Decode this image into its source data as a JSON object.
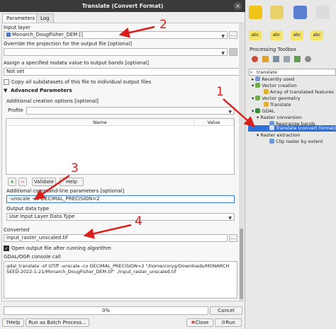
{
  "window": {
    "title": "Translate (Convert Format)",
    "close_icon": "close-icon"
  },
  "tabs": [
    {
      "label": "Parameters"
    },
    {
      "label": "Log"
    }
  ],
  "params": {
    "input_layer_label": "Input layer",
    "input_layer_value": "Monarch_DougFisher_DEM []",
    "projection_label": "Override the projection for the output file [optional]",
    "projection_value": "",
    "nodata_label": "Assign a specified nodata value to output bands [optional]",
    "nodata_value": "Not set",
    "copy_subdatasets_label": "Copy all subdatasets of this file to individual output files",
    "copy_subdatasets_checked": false,
    "advanced_header": "Advanced Parameters",
    "creation_options_label": "Additional creation options [optional]",
    "profile_label": "Profile",
    "profile_value": "",
    "table_columns": [
      "Name",
      "Value"
    ],
    "add_icon": "plus-icon",
    "remove_icon": "minus-icon",
    "validate_label": "Validate",
    "help_inner_label": "Help",
    "cmdline_label": "Additional command-line parameters [optional]",
    "cmdline_value": "-unscale -co DECIMAL_PRECISION=2",
    "data_type_label": "Output data type",
    "data_type_value": "Use Input Layer Data Type",
    "converted_label": "Converted",
    "converted_value": "input_raster_unscaled.tif",
    "open_output_label": "Open output file after running algorithm",
    "open_output_checked": true,
    "console_label": "GDAL/OGR console call",
    "console_text": "gdal_translate -of GTiff -unscale -co DECIMAL_PRECISION=2 \"/home/coryg/Downloads/MONARCH SEED-2022-1-21/Monarch_DougFisher_DEM.tif\" ./input_raster_unscaled.tif"
  },
  "footer": {
    "progress_value": 0,
    "progress_text": "0%",
    "cancel_label": "Cancel",
    "help_label": "Help",
    "batch_label": "Run as Batch Process...",
    "close_label": "Close",
    "run_label": "Run"
  },
  "toolbox": {
    "title": "Processing Toolbox",
    "search_value": "translate",
    "items": [
      {
        "label": "Recently used",
        "icon": "clock-icon"
      },
      {
        "label": "Vector creation",
        "icon": "q-icon"
      },
      {
        "label": "Array of translated features",
        "icon": "tool-icon"
      },
      {
        "label": "Vector geometry",
        "icon": "q-icon"
      },
      {
        "label": "Translate",
        "icon": "tool-icon"
      },
      {
        "label": "GDAL",
        "icon": "gdal-icon"
      },
      {
        "label": "Raster conversion",
        "icon": ""
      },
      {
        "label": "Rearrange bands",
        "icon": "raster-icon"
      },
      {
        "label": "Translate (convert format)",
        "icon": "raster-icon"
      },
      {
        "label": "Raster extraction",
        "icon": ""
      },
      {
        "label": "Clip raster by extent",
        "icon": "raster-icon"
      }
    ]
  },
  "annotations": [
    "1",
    "2",
    "3",
    "4"
  ],
  "colors": {
    "accent_red": "#d8201c",
    "selection_blue": "#2f6fd8",
    "titlebar": "#3a3a3a"
  }
}
